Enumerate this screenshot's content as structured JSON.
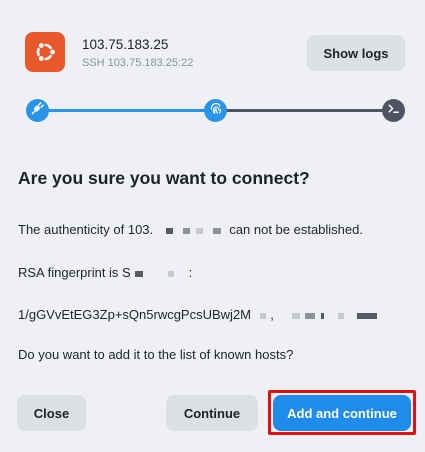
{
  "host": {
    "name": "103.75.183.25",
    "ssh": "SSH 103.75.183.25:22",
    "icon": "ubuntu-icon",
    "icon_color": "#e9582b"
  },
  "toolbar": {
    "show_logs_label": "Show logs"
  },
  "progress": {
    "steps": [
      "plug-icon",
      "fingerprint-icon",
      "terminal-icon"
    ],
    "active_color": "#2a94e8",
    "inactive_color": "#4f5462"
  },
  "dialog": {
    "title": "Are you sure you want to connect?",
    "authenticity_prefix": "The authenticity of 103.",
    "authenticity_suffix": "can not be established.",
    "rsa_prefix": "RSA fingerprint is S",
    "rsa_suffix": ":",
    "fingerprint_visible": "1/gGVvEtEG3Zp+sQn5rwcgPcsUBwj2M",
    "fingerprint_sep": ",",
    "question": "Do you want to add it to the list of known hosts?"
  },
  "buttons": {
    "close": "Close",
    "continue": "Continue",
    "add_continue": "Add and continue",
    "primary_color": "#1f8bea",
    "highlight_color": "#e01010"
  }
}
